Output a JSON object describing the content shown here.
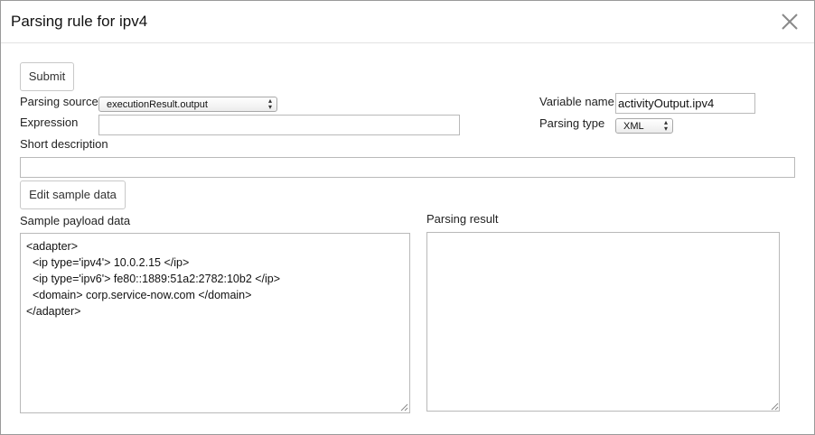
{
  "dialog": {
    "title": "Parsing rule for ipv4",
    "close_icon": "close-icon"
  },
  "form": {
    "submit_label": "Submit",
    "parsing_source_label": "Parsing source",
    "parsing_source_value": "executionResult.output",
    "expression_label": "Expression",
    "expression_value": "",
    "variable_name_label": "Variable name",
    "variable_name_value": "activityOutput.ipv4",
    "parsing_type_label": "Parsing type",
    "parsing_type_value": "XML",
    "short_description_label": "Short description",
    "short_description_value": "",
    "edit_sample_label": "Edit sample data"
  },
  "sample": {
    "label": "Sample payload data",
    "lines": [
      "<adapter>",
      "  <ip type='ipv4'> 10.0.2.15 </ip>",
      "  <ip type='ipv6'> fe80::1889:51a2:2782:10b2 </ip>",
      "  <domain> corp.service-now.com </domain>",
      "</adapter>"
    ]
  },
  "result": {
    "label": "Parsing result",
    "value": ""
  }
}
